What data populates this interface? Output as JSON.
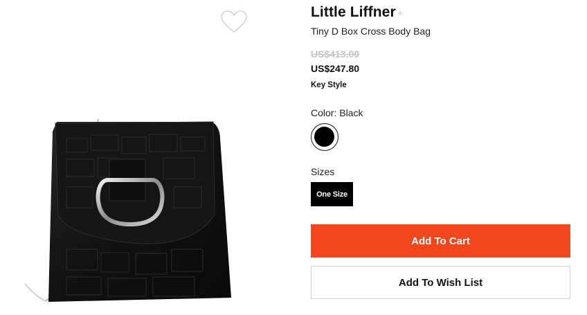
{
  "product": {
    "brand": "Little Liffner",
    "follow_symbol": "+",
    "name": "Tiny D Box Cross Body Bag",
    "original_price": "US$413.00",
    "sale_price": "US$247.80",
    "tag": "Key Style"
  },
  "color": {
    "label": "Color: Black",
    "options": [
      {
        "name": "Black",
        "hex": "#000000",
        "selected": true
      }
    ]
  },
  "sizes": {
    "label": "Sizes",
    "options": [
      {
        "label": "One Size",
        "selected": true
      }
    ]
  },
  "actions": {
    "add_to_cart": "Add To Cart",
    "add_to_wishlist": "Add To Wish List"
  },
  "icons": {
    "wishlist": "heart-outline-icon"
  },
  "theme": {
    "accent": "#f2461c",
    "text": "#111111",
    "muted": "#c4c4c4"
  }
}
